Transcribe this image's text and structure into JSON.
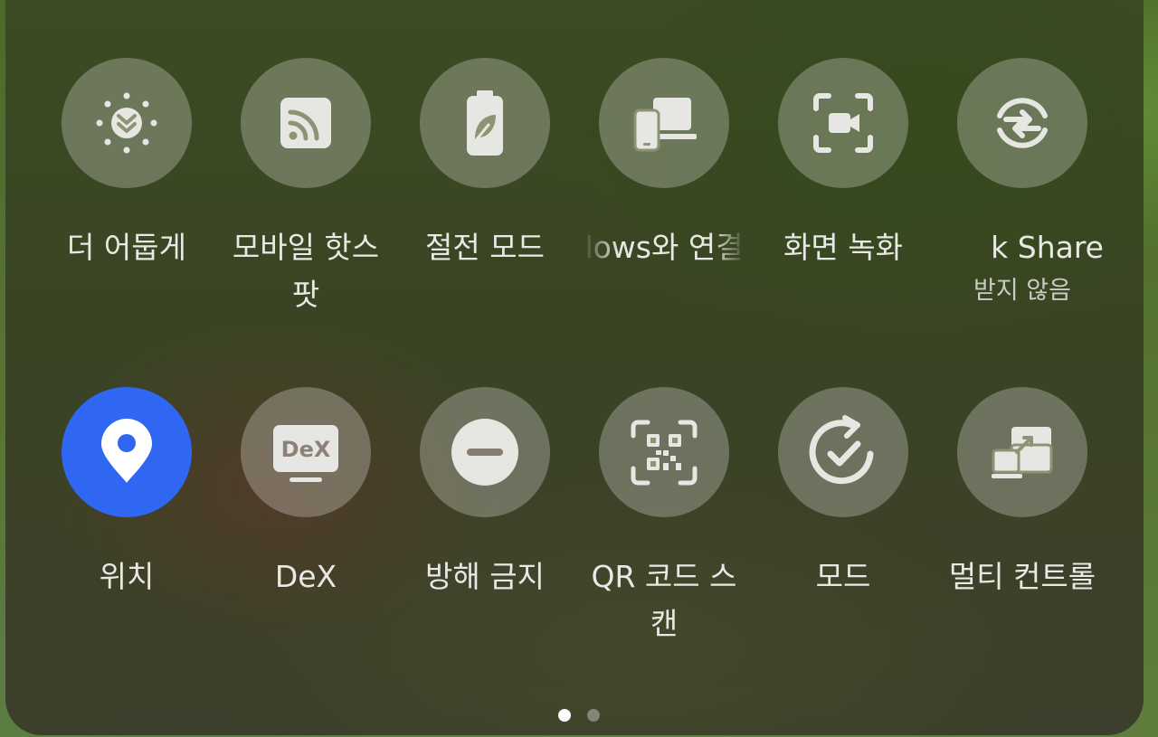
{
  "colors": {
    "tile_background": "rgba(255,255,255,0.26)",
    "tile_active": "#2f67f2",
    "icon": "#e6e6e2",
    "label": "#e8e8e4"
  },
  "tiles_row1": [
    {
      "label": "더 어둡게",
      "icon": "extra-dim-icon",
      "active": false
    },
    {
      "label": "모바일 핫스팟",
      "icon": "mobile-hotspot-icon",
      "active": false
    },
    {
      "label": "절전 모드",
      "icon": "power-saving-icon",
      "active": false
    },
    {
      "label": "lows와 연결",
      "icon": "link-to-windows-icon",
      "active": false
    },
    {
      "label": "화면 녹화",
      "icon": "screen-recorder-icon",
      "active": false
    },
    {
      "label": "k Share",
      "sublabel": "받지 않음",
      "icon": "quick-share-icon",
      "active": false
    }
  ],
  "tiles_row2": [
    {
      "label": "위치",
      "icon": "location-icon",
      "active": true
    },
    {
      "label": "DeX",
      "icon_text": "DeX",
      "icon": "dex-icon",
      "active": false
    },
    {
      "label": "방해 금지",
      "icon": "do-not-disturb-icon",
      "active": false
    },
    {
      "label": "QR 코드 스캔",
      "icon": "qr-scan-icon",
      "active": false
    },
    {
      "label": "모드",
      "icon": "modes-icon",
      "active": false
    },
    {
      "label": "멀티 컨트롤",
      "icon": "multi-control-icon",
      "active": false
    }
  ],
  "page_indicator": {
    "pages": 2,
    "current": 1
  }
}
